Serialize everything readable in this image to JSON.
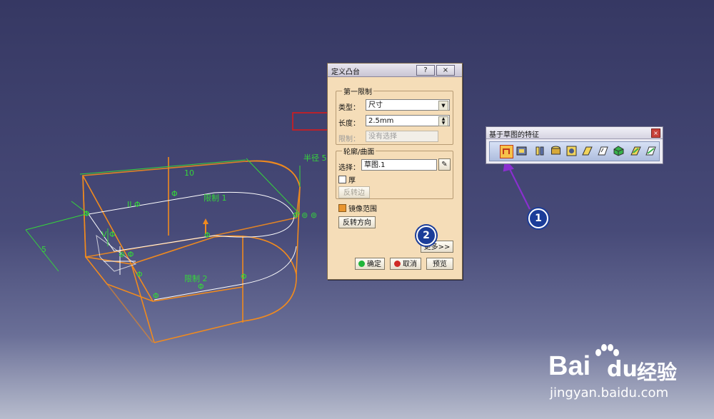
{
  "viewport": {
    "labels": {
      "dim_radius": "半径 5",
      "dim_10": "10",
      "dim_5": "5",
      "limit1": "限制 1",
      "limit2": "限制 2",
      "sym1": "Φ",
      "sym2": "Φ",
      "sym3": "Φ",
      "sym_right": "Φ ⊚ ⊚",
      "sym_ii": "II Φ",
      "sym_v": "V Φ",
      "sym_center": "⊕ Φ",
      "sym4": "Φ",
      "sym5": "Φ",
      "sym6": "Φ",
      "sym7": "Φ"
    }
  },
  "dialog": {
    "title": "定义凸台",
    "help_btn": "?",
    "close_btn": "×",
    "first_limit": {
      "legend": "第一限制",
      "type_label": "类型：",
      "type_value": "尺寸",
      "length_label": "长度：",
      "length_value": "2.5mm",
      "limit_label": "限制：",
      "limit_value": "没有选择"
    },
    "profile": {
      "legend": "轮廓/曲面",
      "select_label": "选择：",
      "select_value": "草图.1",
      "thick_label": "厚",
      "reverse_side": "反转边"
    },
    "mirror_label": "镜像范围",
    "reverse_direction": "反转方向",
    "more": "更多>>",
    "ok": "确定",
    "cancel": "取消",
    "preview": "预览"
  },
  "toolbar": {
    "title": "基于草图的特征",
    "close": "×",
    "icons": [
      "pad-icon",
      "pocket-icon",
      "shaft-icon",
      "groove-icon",
      "hole-icon",
      "rib-icon",
      "slot-icon",
      "solid-combine-icon",
      "stiffener-icon",
      "multi-section-solid-icon"
    ]
  },
  "annotations": {
    "badge1": "1",
    "badge2": "2"
  },
  "watermark": {
    "brand": "Bai",
    "brand_du": "du",
    "brand_cn": "经验",
    "url": "jingyan.baidu.com"
  },
  "colors": {
    "geometry": "#f08a1e",
    "dimension": "#35d63a",
    "annotation_arrow": "#8a2fd0",
    "highlight_box": "#d81b1b",
    "badge": "#1b3d99"
  }
}
